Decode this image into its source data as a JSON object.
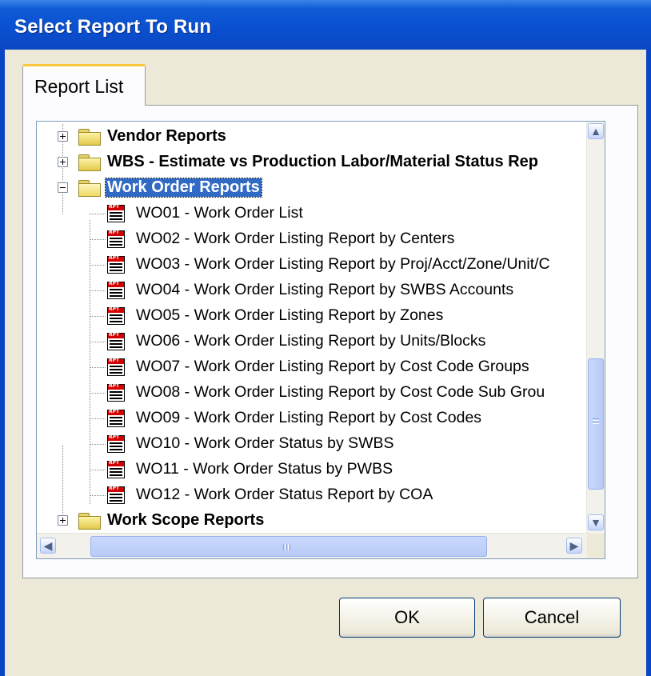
{
  "window": {
    "title": "Select Report To Run"
  },
  "tabs": [
    {
      "label": "Report List"
    }
  ],
  "tree": {
    "folders": [
      {
        "label": "Vendor Reports",
        "expanded": false
      },
      {
        "label": "WBS - Estimate vs Production Labor/Material Status Rep",
        "expanded": false
      },
      {
        "label": "Work Order Reports",
        "expanded": true,
        "selected": true
      },
      {
        "label": "Work Scope Reports",
        "expanded": false
      }
    ],
    "reports": [
      "WO01 - Work Order List",
      "WO02 - Work Order Listing Report by Centers",
      "WO03 - Work Order Listing Report by Proj/Acct/Zone/Unit/C",
      "WO04 - Work Order Listing Report by SWBS Accounts",
      "WO05 - Work Order Listing Report by Zones",
      "WO06 - Work Order Listing Report by Units/Blocks",
      "WO07 - Work Order Listing Report by Cost Code Groups",
      "WO08 - Work Order Listing Report by Cost Code Sub Grou",
      "WO09 - Work Order Listing Report by Cost Codes",
      "WO10 - Work Order Status by SWBS",
      "WO11 - Work Order Status by PWBS",
      "WO12 - Work Order Status Report by COA"
    ]
  },
  "buttons": {
    "ok": "OK",
    "cancel": "Cancel"
  },
  "icons": {
    "scroll_up": "▲",
    "scroll_down": "▼",
    "scroll_left": "◀",
    "scroll_right": "▶",
    "expander_plus": "plus-box-icon",
    "expander_minus": "minus-box-icon",
    "folder": "folder-icon",
    "report": "report-icon"
  }
}
